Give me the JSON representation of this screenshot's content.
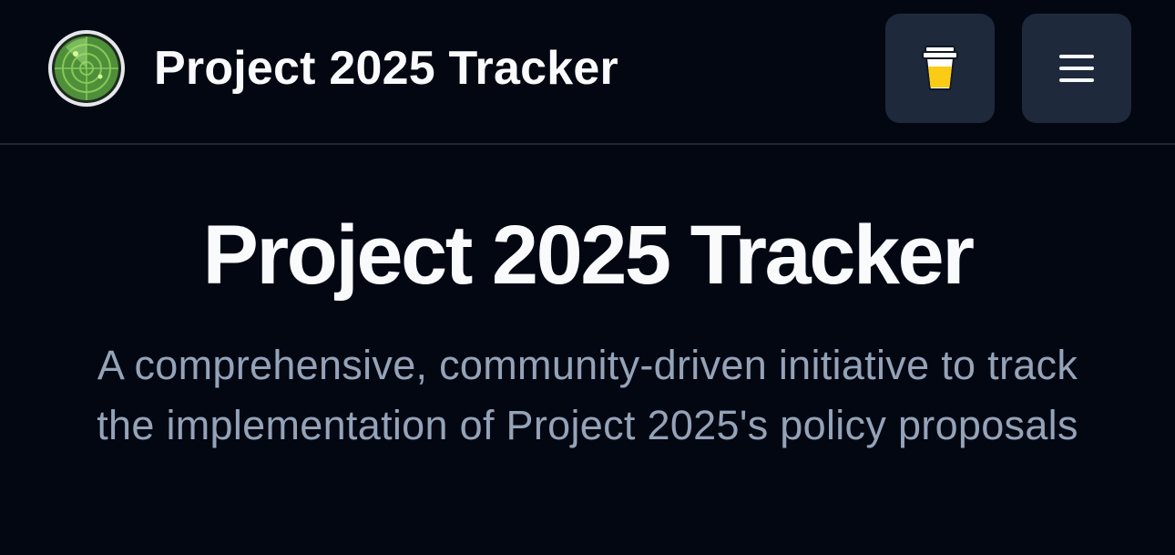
{
  "header": {
    "brand_title": "Project 2025 Tracker",
    "logo_icon": "radar-icon",
    "coffee_button_icon": "coffee-cup-icon",
    "menu_button_icon": "hamburger-menu-icon"
  },
  "hero": {
    "title": "Project 2025 Tracker",
    "subtitle": "A comprehensive, community-driven initiative to track the implementation of Project 2025's policy proposals"
  },
  "colors": {
    "background": "#030712",
    "header_border": "#1f2937",
    "button_bg": "#1e293b",
    "title_text": "#f8fafc",
    "subtitle_text": "#94a3b8",
    "radar_green": "#4ade80",
    "coffee_yellow": "#facc15"
  }
}
